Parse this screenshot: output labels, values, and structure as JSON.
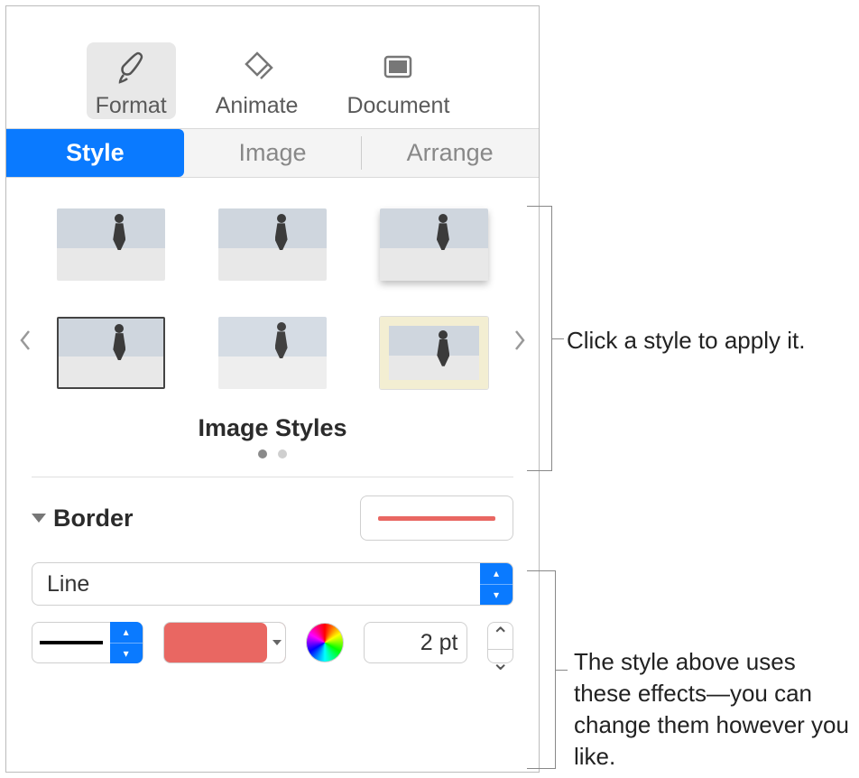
{
  "toolbar": {
    "format": "Format",
    "animate": "Animate",
    "document": "Document"
  },
  "tabs": {
    "style": "Style",
    "image": "Image",
    "arrange": "Arrange"
  },
  "styles": {
    "title": "Image Styles"
  },
  "border": {
    "label": "Border",
    "type": "Line",
    "size": "2 pt",
    "color": "#e96762"
  },
  "callouts": {
    "c1": "Click a style to apply it.",
    "c2": "The style above uses these effects—you can change them however you like."
  }
}
